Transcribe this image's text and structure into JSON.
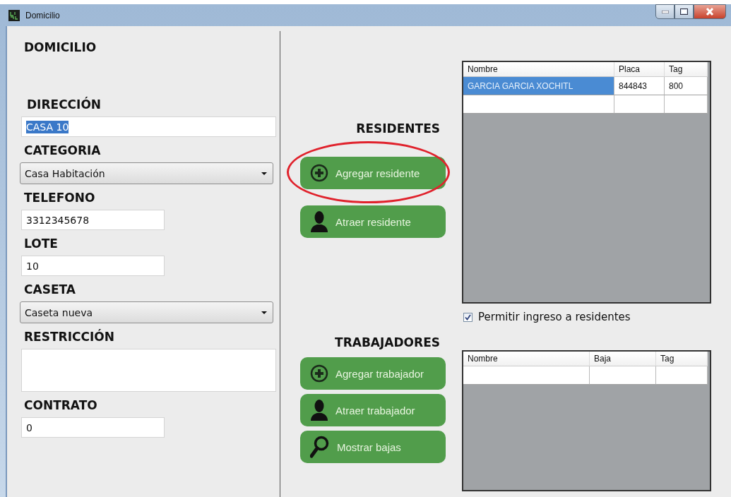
{
  "window": {
    "title": "Domicilio"
  },
  "domicilio": {
    "heading": "DOMICILIO",
    "fields": [
      {
        "kind": "text",
        "label": "DIRECCIÓN",
        "value": "CASA 10",
        "text_selected": true
      },
      {
        "kind": "dropdown",
        "label": "CATEGORIA",
        "value": "Casa Habitación"
      },
      {
        "kind": "text",
        "label": "TELEFONO",
        "value": "3312345678",
        "text_selected": false
      },
      {
        "kind": "text",
        "label": "LOTE",
        "value": "10",
        "text_selected": false
      },
      {
        "kind": "dropdown",
        "label": "CASETA",
        "value": "Caseta nueva"
      },
      {
        "kind": "multiline",
        "label": "RESTRICCIÓN"
      },
      {
        "kind": "text",
        "label": "CONTRATO",
        "value": "0",
        "text_selected": false
      }
    ]
  },
  "residentes": {
    "heading": "RESIDENTES",
    "buttons": [
      {
        "kind": "add",
        "label": "Agregar residente",
        "highlighted": true
      },
      {
        "kind": "fetch",
        "label": "Atraer residente",
        "highlighted": false
      }
    ],
    "table": {
      "columns": [
        "Nombre",
        "Placa",
        "Tag"
      ],
      "rows": [
        {
          "cells": [
            "GARCIA GARCIA XOCHITL",
            "844843",
            "800"
          ],
          "selected": true
        }
      ],
      "new_row": true
    },
    "allow_entry": {
      "label": "Permitir ingreso a residentes",
      "checked": true
    }
  },
  "trabajadores": {
    "heading": "TRABAJADORES",
    "buttons": [
      {
        "kind": "add",
        "label": "Agregar trabajador",
        "highlighted": false
      },
      {
        "kind": "fetch",
        "label": "Atraer trabajador",
        "highlighted": false
      },
      {
        "kind": "show",
        "label": "Mostrar bajas",
        "highlighted": false
      }
    ],
    "table": {
      "columns": [
        "Nombre",
        "Baja",
        "Tag"
      ],
      "new_row": true
    }
  }
}
